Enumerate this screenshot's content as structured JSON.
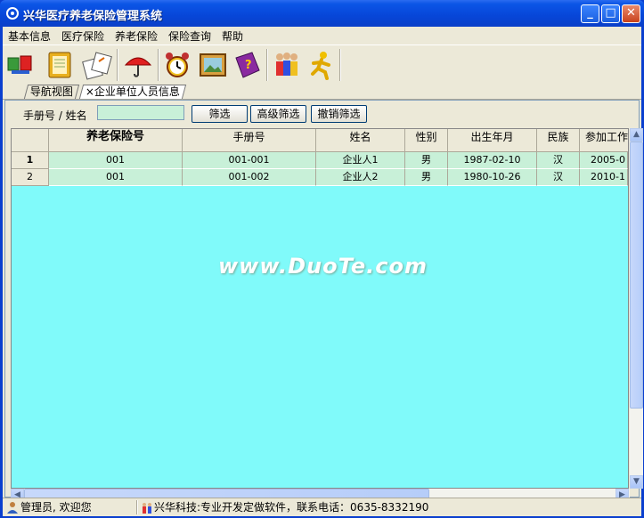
{
  "window": {
    "title": "兴华医疗养老保险管理系统",
    "buttons": [
      "_",
      "□",
      "✕"
    ]
  },
  "menu": [
    "基本信息",
    "医疗保险",
    "养老保险",
    "保险查询",
    "帮助"
  ],
  "toolbar_icons": [
    "network-cards-icon",
    "open-book-icon",
    "documents-icon",
    "umbrella-icon",
    "alarm-clock-icon",
    "picture-icon",
    "help-book-icon",
    "users-icon",
    "exit-runner-icon"
  ],
  "tabs": [
    {
      "label": "导航视图"
    },
    {
      "label": "×企业单位人员信息"
    }
  ],
  "filter": {
    "label": "手册号 / 姓名",
    "value": "",
    "buttons": [
      "筛选",
      "高级筛选",
      "撤销筛选"
    ]
  },
  "table": {
    "columns": [
      "养老保险号",
      "手册号",
      "姓名",
      "性别",
      "出生年月",
      "民族",
      "参加工作"
    ],
    "rows": [
      {
        "num": "1",
        "cells": [
          "001",
          "001-001",
          "企业人1",
          "男",
          "1987-02-10",
          "汉",
          "2005-0"
        ]
      },
      {
        "num": "2",
        "cells": [
          "001",
          "001-002",
          "企业人2",
          "男",
          "1980-10-26",
          "汉",
          "2010-1"
        ]
      }
    ]
  },
  "watermark": "www.DuoTe.com",
  "status": {
    "user": "管理员, 欢迎您",
    "company": "兴华科技:专业开发定做软件，联系电话：0635-8332190"
  },
  "colors": {
    "grid_background": "#80fafa",
    "row_background": "#c8f0d8",
    "title_bar": "#0746d8"
  }
}
